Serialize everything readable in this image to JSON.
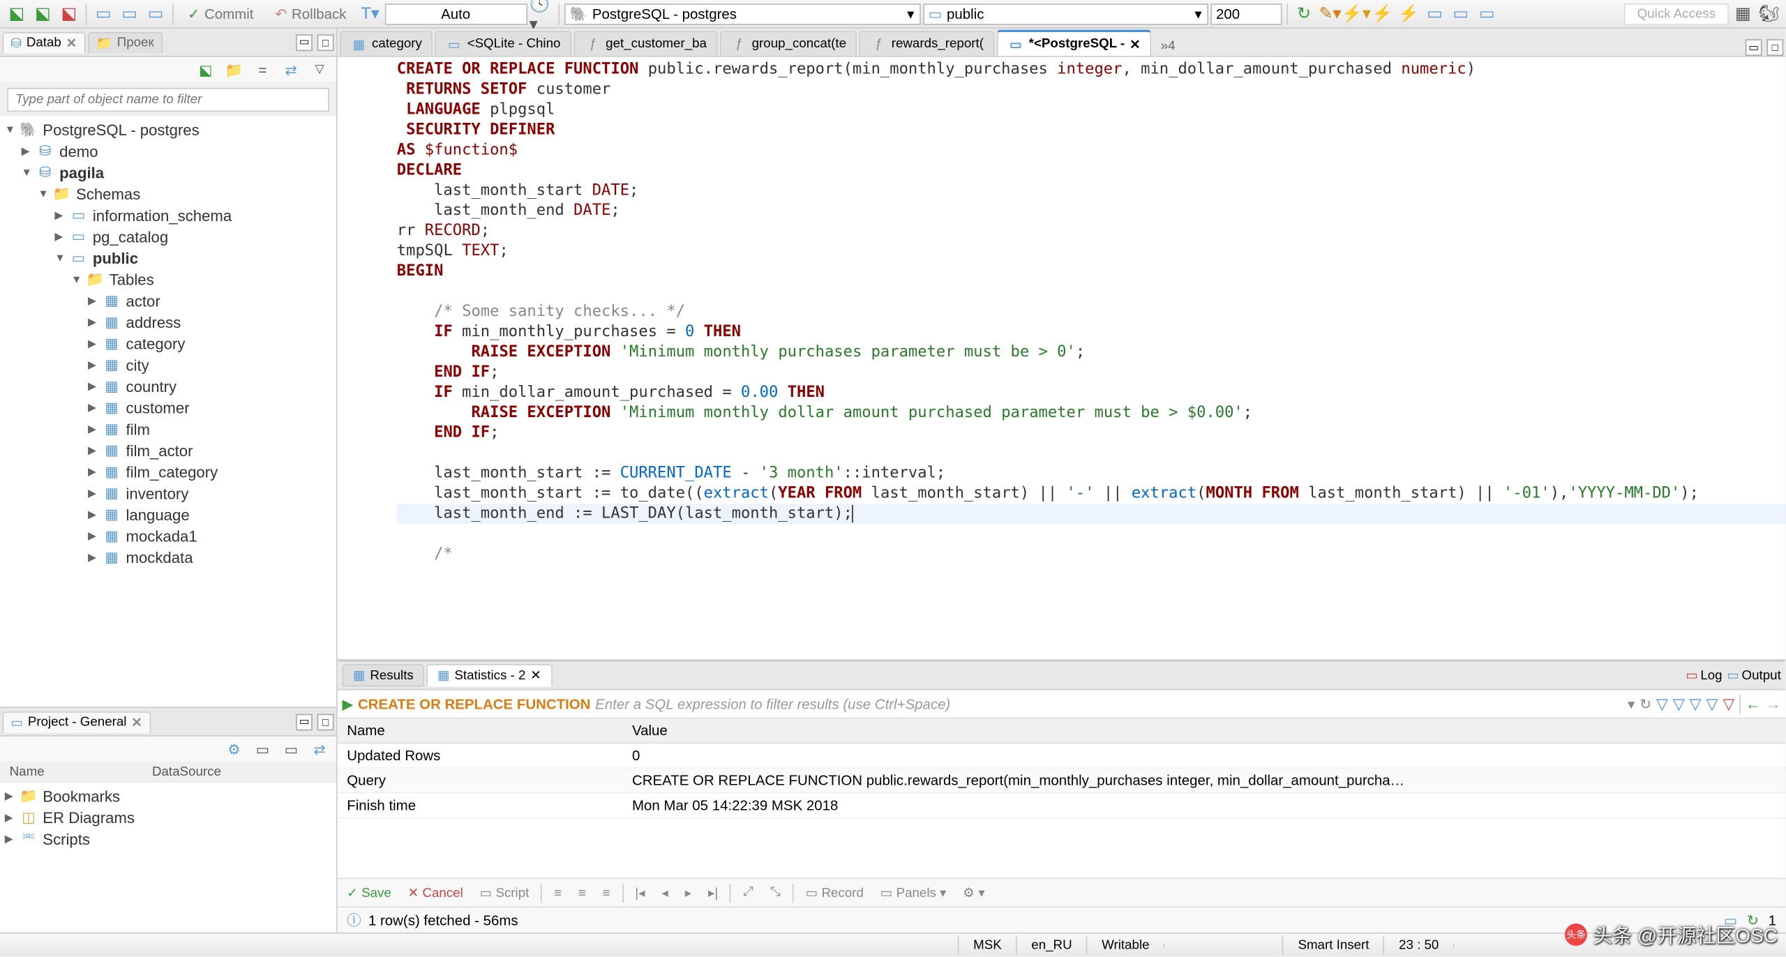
{
  "toolbar": {
    "commit_label": "Commit",
    "rollback_label": "Rollback",
    "mode": "Auto",
    "connection": "PostgreSQL - postgres",
    "schema": "public",
    "limit": "200",
    "quick_access": "Quick Access"
  },
  "left_tabs": {
    "tab1": "Datab",
    "tab2": "Проек"
  },
  "nav": {
    "filter_placeholder": "Type part of object name to filter",
    "conn": "PostgreSQL - postgres",
    "db1": "demo",
    "db2": "pagila",
    "schemas": "Schemas",
    "schema1": "information_schema",
    "schema2": "pg_catalog",
    "schema3": "public",
    "tables": "Tables",
    "t1": "actor",
    "t2": "address",
    "t3": "category",
    "t4": "city",
    "t5": "country",
    "t6": "customer",
    "t7": "film",
    "t8": "film_actor",
    "t9": "film_category",
    "t10": "inventory",
    "t11": "language",
    "t12": "mockada1",
    "t13": "mockdata"
  },
  "editor_tabs": {
    "t1": "category",
    "t2": "<SQLite - Chino",
    "t3": "get_customer_ba",
    "t4": "group_concat(te",
    "t5": "rewards_report(",
    "t6": "*<PostgreSQL - ",
    "more": "»4"
  },
  "results": {
    "tab1": "Results",
    "tab2": "Statistics - 2",
    "log": "Log",
    "output": "Output",
    "filter_label": "CREATE OR REPLACE FUNCTION",
    "filter_placeholder": "Enter a SQL expression to filter results (use Ctrl+Space)",
    "col1": "Name",
    "col2": "Value",
    "row1_name": "Updated Rows",
    "row1_val": "0",
    "row2_name": "Query",
    "row2_val": "CREATE OR REPLACE FUNCTION public.rewards_report(min_monthly_purchases integer, min_dollar_amount_purcha…",
    "row3_name": "Finish time",
    "row3_val": "Mon Mar 05 14:22:39 MSK 2018"
  },
  "bottom_toolbar": {
    "save": "Save",
    "cancel": "Cancel",
    "script": "Script",
    "record": "Record",
    "panels": "Panels",
    "refresh_count": "1"
  },
  "fetch": {
    "status": "1 row(s) fetched - 56ms"
  },
  "project": {
    "title": "Project - General",
    "col1": "Name",
    "col2": "DataSource",
    "item1": "Bookmarks",
    "item2": "ER Diagrams",
    "item3": "Scripts"
  },
  "statusbar": {
    "tz": "MSK",
    "locale": "en_RU",
    "writable": "Writable",
    "insert": "Smart Insert",
    "pos": "23 : 50"
  },
  "watermark": "头条 @开源社区OSC"
}
